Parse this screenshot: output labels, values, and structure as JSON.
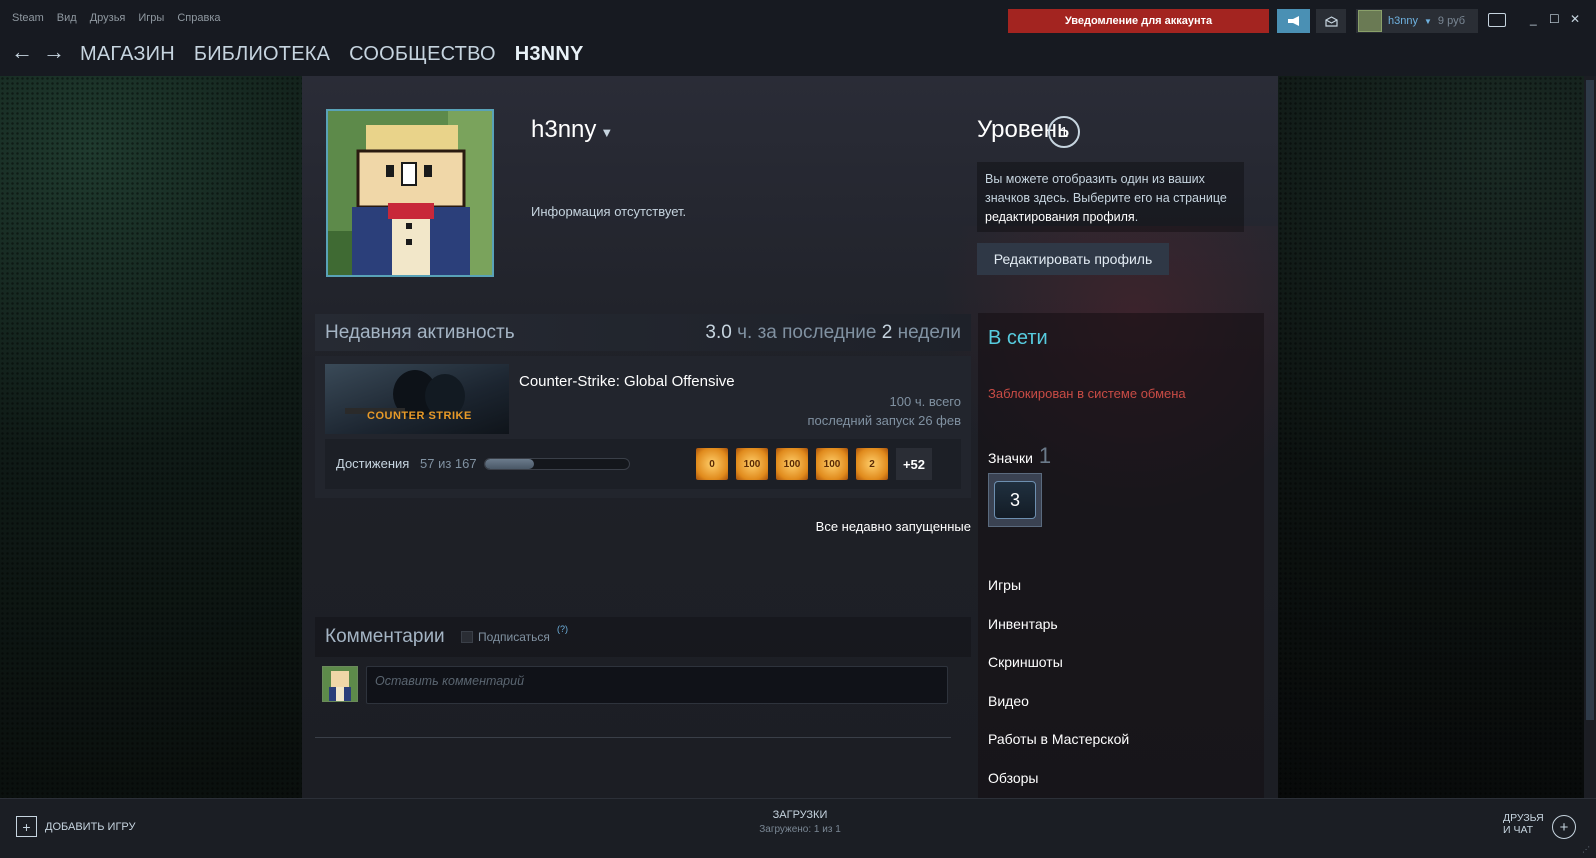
{
  "menu": [
    "Steam",
    "Вид",
    "Друзья",
    "Игры",
    "Справка"
  ],
  "topbar": {
    "notification": "Уведомление для аккаунта",
    "username": "h3nny",
    "wallet": "9 руб"
  },
  "nav": {
    "links": [
      "МАГАЗИН",
      "БИБЛИОТЕКА",
      "СООБЩЕСТВО",
      "H3NNY"
    ],
    "active_index": 3
  },
  "profile": {
    "name": "h3nny",
    "info": "Информация отсутствует.",
    "level_label": "Уровень",
    "level": "1",
    "level_hint_prefix": "Вы можете отобразить один из ваших значков здесь. Выберите его на странице ",
    "level_hint_link": "редактирования профиля",
    "level_hint_suffix": ".",
    "edit_button": "Редактировать профиль"
  },
  "recent": {
    "title": "Недавняя активность",
    "hours_value": "3.0",
    "hours_mid": " ч. за последние ",
    "hours_weeks": "2",
    "hours_suffix": " недели",
    "game": {
      "name": "Counter-Strike: Global Offensive",
      "capsule_logo": "COUNTER STRIKE",
      "total_hours": "100 ч. всего",
      "last_played": "последний запуск 26 фев",
      "achievements_label": "Достижения",
      "achievements_count": "57 из 167",
      "achievements_fraction": 0.341,
      "achievement_icons": [
        "0",
        "100",
        "100",
        "100",
        "2"
      ],
      "more": "+52"
    },
    "all_link": "Все недавно запущенные"
  },
  "comments": {
    "title": "Комментарии",
    "subscribe": "Подписаться",
    "help": "(?)",
    "placeholder": "Оставить комментарий"
  },
  "sidebar": {
    "status": "В сети",
    "trade_ban": "Заблокирован в системе обмена",
    "badges_label": "Значки",
    "badges_count": "1",
    "badge_level": "3",
    "links": [
      "Игры",
      "Инвентарь",
      "Скриншоты",
      "Видео",
      "Работы в Мастерской",
      "Обзоры"
    ]
  },
  "bottom": {
    "add_game": "ДОБАВИТЬ ИГРУ",
    "downloads_title": "ЗАГРУЗКИ",
    "downloads_status": "Загружено: 1 из 1",
    "friends_line1": "ДРУЗЬЯ",
    "friends_line2": "И ЧАТ"
  },
  "colors": {
    "notification_bg": "#a32420",
    "online": "#57cbde",
    "trade_ban": "#c84b45",
    "link_blue": "#6fb2e0"
  }
}
